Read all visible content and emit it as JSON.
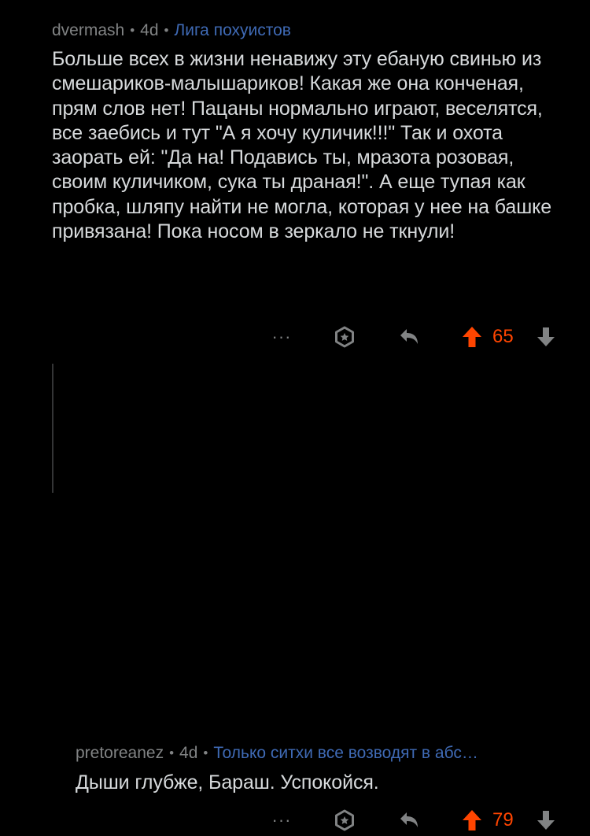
{
  "comments": [
    {
      "username": "dvermash",
      "separator": "•",
      "time": "4d",
      "flair": "Лига похуистов",
      "body": "Больше всех в жизни ненавижу эту ебаную свинью из смешариков-малышариков! Какая же она конченая, прям слов нет! Пацаны нормально играют, веселятся, все заебись и тут \"А я хочу куличик!!!\" Так и охота заорать ей: \"Да на! Подавись ты, мразота розовая, своим куличиком, сука ты драная!\". А еще тупая как пробка, шляпу найти не могла, которая у нее на башке привязана! Пока носом в зеркало не ткнули!",
      "actions": {
        "more": "···",
        "score": "65"
      }
    },
    {
      "username": "pretoreanez",
      "separator": "•",
      "time": "4d",
      "flair": "Только ситхи все возводят в абс…",
      "body": "Дыши глубже, Бараш. Успокойся.",
      "actions": {
        "more": "···",
        "score": "79"
      }
    }
  ],
  "icons": {
    "more": "more-options-icon",
    "award": "award-icon",
    "reply": "reply-icon",
    "upvote": "upvote-icon",
    "downvote": "downvote-icon"
  },
  "colors": {
    "background": "#000000",
    "meta_text": "#818384",
    "flair": "#3f6ab5",
    "body_text": "#d7dadc",
    "upvoted": "#ff4500",
    "icon": "#818384",
    "thread_line": "#343536"
  }
}
